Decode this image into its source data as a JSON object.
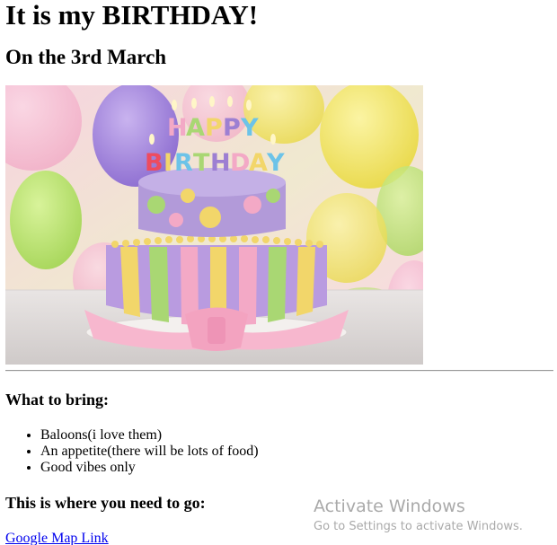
{
  "heading": {
    "title": "It is my BIRTHDAY!",
    "date": "On the 3rd March"
  },
  "image": {
    "subject": "birthday-cake-photo",
    "cake_topper_text": "HAPPY BIRTHDAY",
    "colors": {
      "background_pink": "#f4c6d8",
      "balloon_purple": "#a57fd6",
      "balloon_yellow": "#f3e35a",
      "balloon_green": "#b8e36a",
      "cake_top": "#b29ad9",
      "stripe_yellow": "#f2d66a",
      "stripe_pink": "#f3a9c6",
      "stripe_purple": "#9d7fd2",
      "stripe_green": "#a9d773",
      "bow_pink": "#f7b7ce"
    }
  },
  "bring_section": {
    "heading": "What to bring:",
    "items": [
      "Baloons(i love them)",
      "An appetite(there will be lots of food)",
      "Good vibes only"
    ]
  },
  "location_section": {
    "heading": "This is where you need to go:",
    "link_text": "Google Map Link"
  },
  "windows_watermark": {
    "title": "Activate Windows",
    "subtitle": "Go to Settings to activate Windows."
  }
}
